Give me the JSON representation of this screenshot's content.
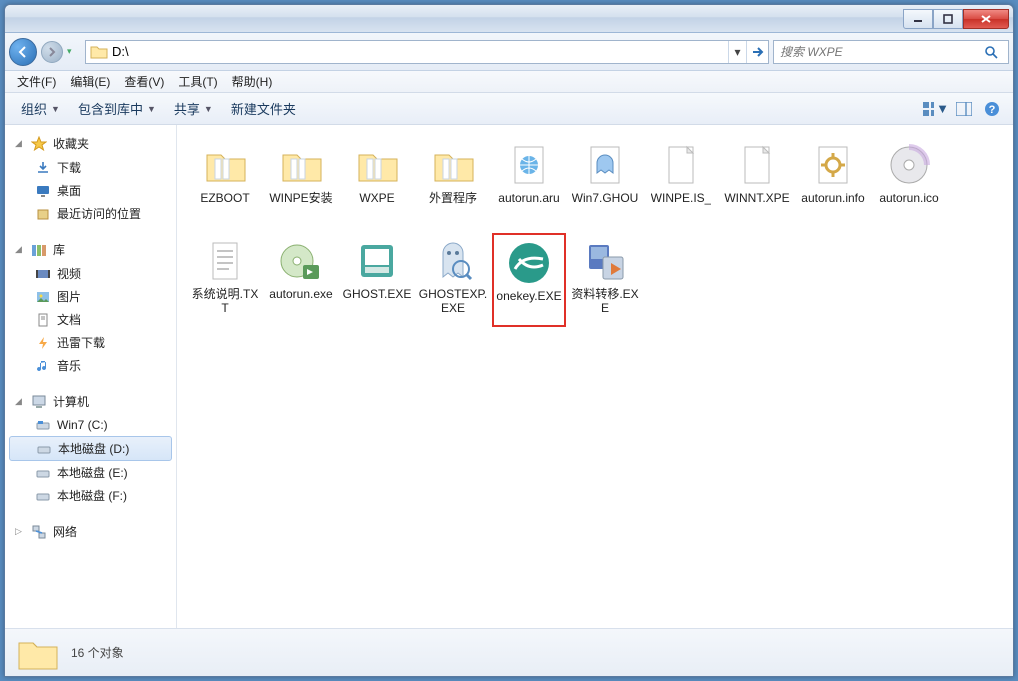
{
  "window": {
    "min": "—",
    "max": "☐",
    "close": "✕"
  },
  "address": {
    "path": "D:\\"
  },
  "search": {
    "placeholder": "搜索 WXPE"
  },
  "menubar": [
    "文件(F)",
    "编辑(E)",
    "查看(V)",
    "工具(T)",
    "帮助(H)"
  ],
  "toolbar": {
    "organize": "组织",
    "include": "包含到库中",
    "share": "共享",
    "newfolder": "新建文件夹"
  },
  "sidebar": {
    "favorites": {
      "label": "收藏夹",
      "items": [
        "下载",
        "桌面",
        "最近访问的位置"
      ]
    },
    "libraries": {
      "label": "库",
      "items": [
        "视频",
        "图片",
        "文档",
        "迅雷下载",
        "音乐"
      ]
    },
    "computer": {
      "label": "计算机",
      "items": [
        "Win7 (C:)",
        "本地磁盘 (D:)",
        "本地磁盘 (E:)",
        "本地磁盘 (F:)"
      ],
      "selected": 1
    },
    "network": {
      "label": "网络"
    }
  },
  "files": [
    {
      "name": "EZBOOT",
      "type": "folder"
    },
    {
      "name": "WINPE安装",
      "type": "folder"
    },
    {
      "name": "WXPE",
      "type": "folder"
    },
    {
      "name": "外置程序",
      "type": "folder"
    },
    {
      "name": "autorun.aru",
      "type": "html"
    },
    {
      "name": "Win7.GHOU",
      "type": "ghost"
    },
    {
      "name": "WINPE.IS_",
      "type": "file"
    },
    {
      "name": "WINNT.XPE",
      "type": "file"
    },
    {
      "name": "autorun.info",
      "type": "gear"
    },
    {
      "name": "autorun.ico",
      "type": "disc"
    },
    {
      "name": "系统说明.TXT",
      "type": "txt"
    },
    {
      "name": "autorun.exe",
      "type": "disc-exe"
    },
    {
      "name": "GHOST.EXE",
      "type": "ghost-app"
    },
    {
      "name": "GHOSTEXP.EXE",
      "type": "ghost-exp"
    },
    {
      "name": "onekey.EXE",
      "type": "onekey",
      "highlighted": true
    },
    {
      "name": "资料转移.EXE",
      "type": "transfer"
    }
  ],
  "status": {
    "count": "16 个对象"
  }
}
